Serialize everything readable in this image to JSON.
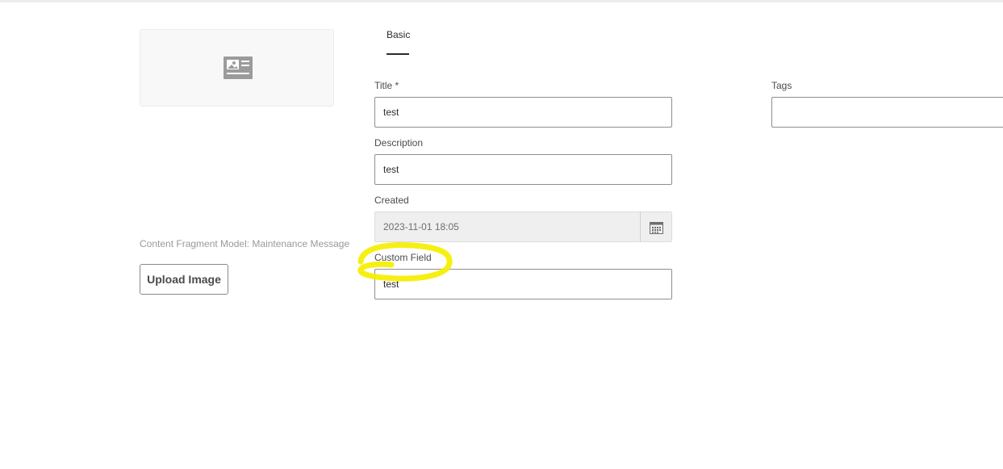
{
  "tabs": [
    {
      "label": "Basic",
      "selected": true
    }
  ],
  "thumbnail": {
    "icon": "content-fragment-card-icon"
  },
  "model_label": "Content Fragment Model: Maintenance Message",
  "upload_button": {
    "label": "Upload Image"
  },
  "form": {
    "title": {
      "label": "Title *",
      "value": "test"
    },
    "description": {
      "label": "Description",
      "value": "test"
    },
    "created": {
      "label": "Created",
      "value": "2023-11-01 18:05",
      "disabled": true,
      "icon": "calendar-icon"
    },
    "custom_field": {
      "label": "Custom Field",
      "value": "test"
    },
    "tags": {
      "label": "Tags",
      "value": ""
    }
  },
  "annotation": {
    "type": "highlighter-circle",
    "color": "#f5ee00",
    "target": "Custom Field"
  }
}
